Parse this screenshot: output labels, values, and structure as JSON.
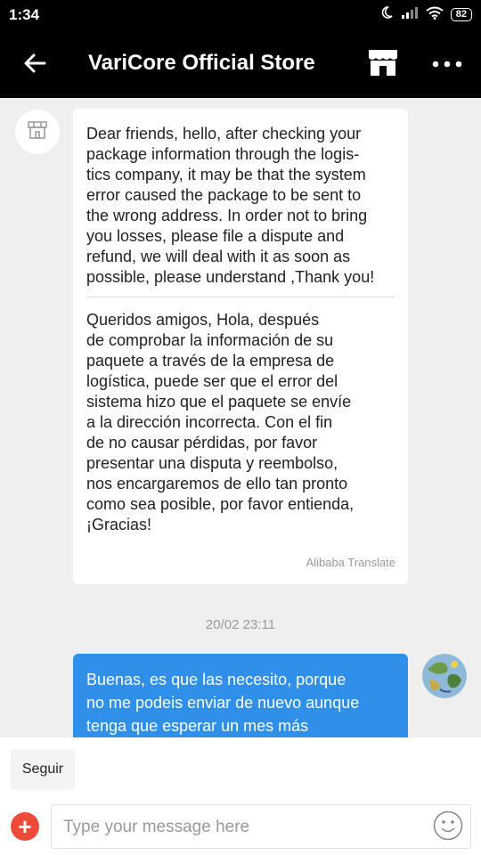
{
  "status_bar": {
    "time": "1:34",
    "battery": "82",
    "icons": [
      "moon-icon",
      "signal-icon",
      "wifi-icon",
      "battery-icon"
    ]
  },
  "header": {
    "title": "VariCore Official Store",
    "icons": [
      "back-arrow-icon",
      "store-icon",
      "more-icon"
    ]
  },
  "messages": {
    "incoming": {
      "text_en": "Dear friends, hello, after checking your\npackage information through the logis-\ntics company, it may be that the system\nerror caused the package to be sent to\nthe wrong address. In order not to bring\nyou losses, please file a dispute and\nrefund, we will deal with it as soon as\npossible, please understand ,Thank you!",
      "text_es": "Queridos amigos, Hola, después\nde comprobar la información de su\npaquete a través de la empresa de\nlogística, puede ser que el error del\nsistema hizo que el paquete se envíe\na la dirección incorrecta. Con el fin\nde no causar pérdidas, por favor\npresentar una disputa y reembolso,\nnos encargaremos de ello tan pronto\ncomo sea posible, por favor entienda,\n¡Gracias!",
      "translate_label": "Alibaba Translate"
    },
    "timestamp": "20/02 23:11",
    "outgoing": {
      "text": "Buenas, es que las necesito, porque\nno me podeis enviar de nuevo aunque\ntenga que esperar un mes más"
    }
  },
  "bottom": {
    "seguir_label": "Seguir",
    "input_placeholder": "Type your message here",
    "plus_label": "+"
  },
  "colors": {
    "header_bg": "#000000",
    "chat_bg": "#efefef",
    "outgoing_bubble": "#2f8fe9",
    "plus_button": "#f04a3a"
  }
}
